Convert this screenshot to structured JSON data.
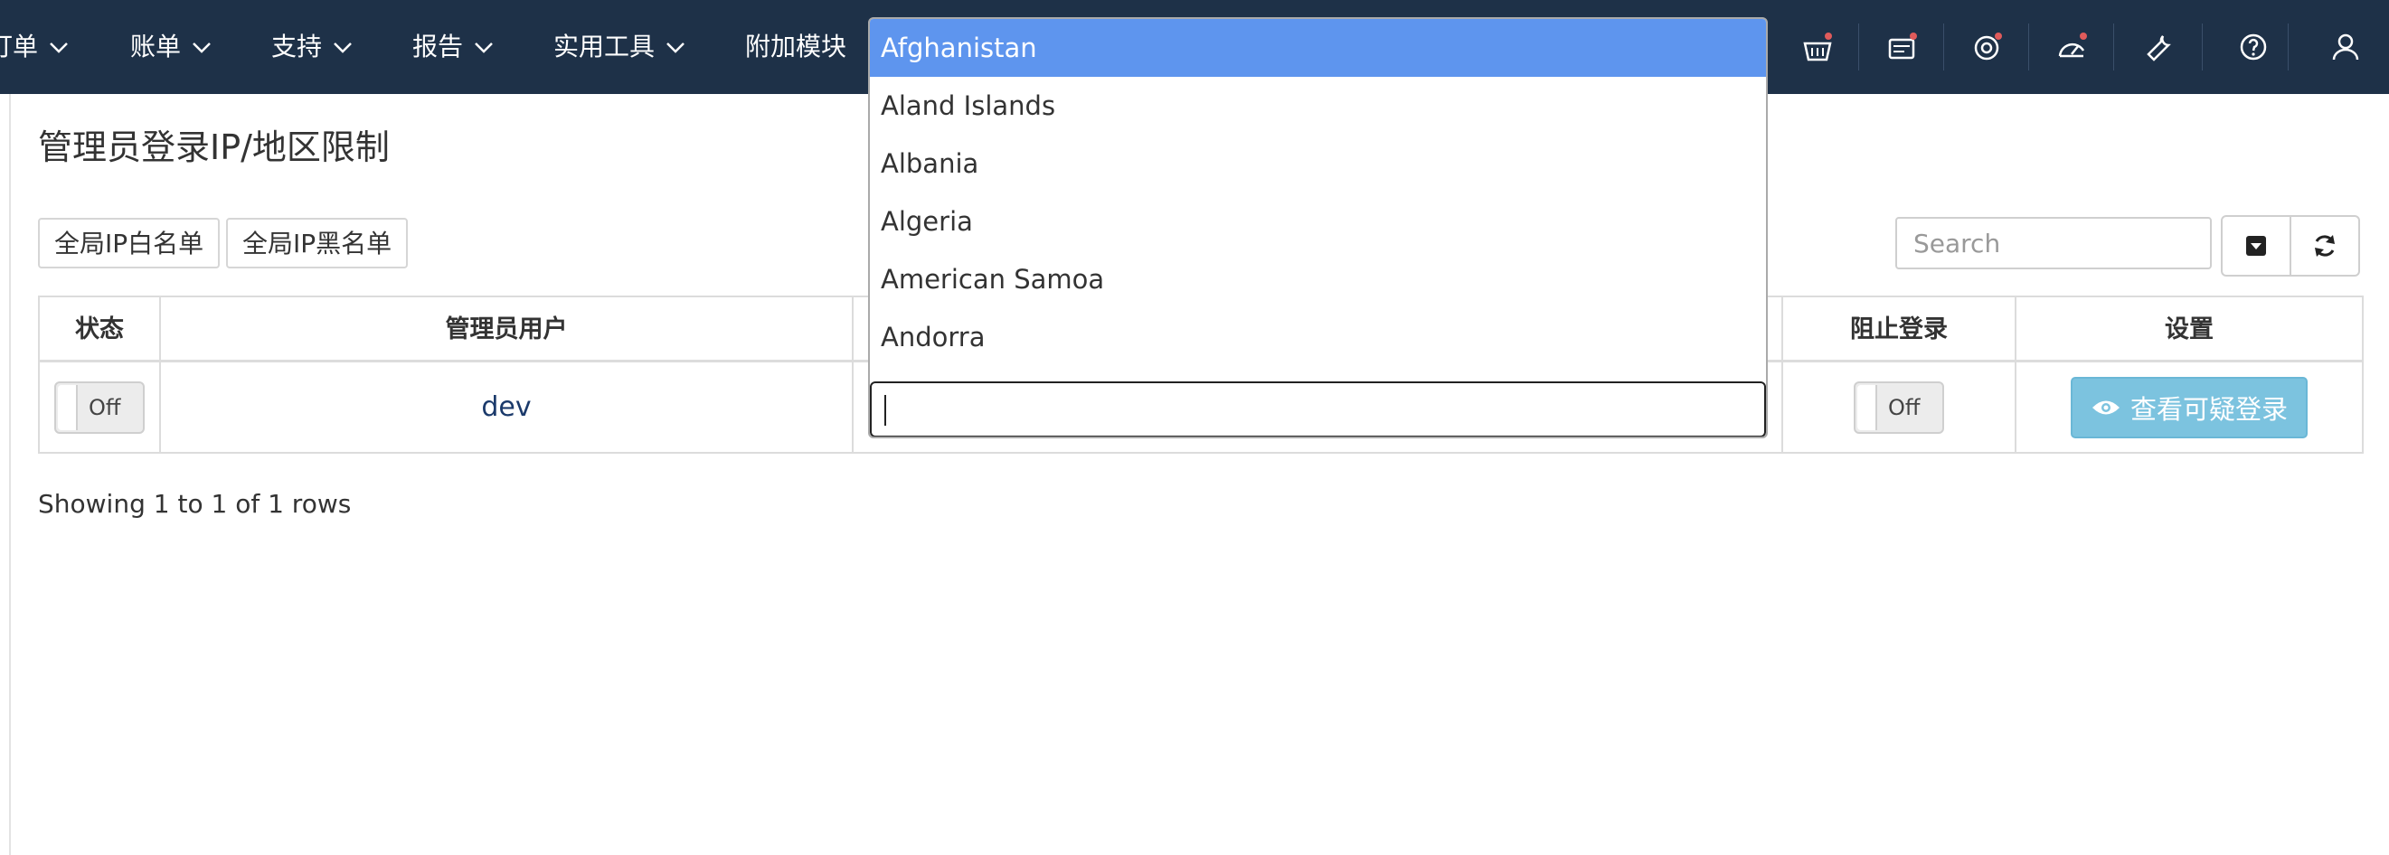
{
  "nav": {
    "items": [
      {
        "label": "订单"
      },
      {
        "label": "账单"
      },
      {
        "label": "支持"
      },
      {
        "label": "报告"
      },
      {
        "label": "实用工具"
      },
      {
        "label": "附加模块"
      }
    ],
    "icons": [
      "basket-icon",
      "billing-icon",
      "support-icon",
      "speedometer-icon",
      "wrench-icon",
      "help-icon",
      "user-icon"
    ]
  },
  "page": {
    "title": "管理员登录IP/地区限制"
  },
  "toolbar": {
    "whitelist_label": "全局IP白名单",
    "blacklist_label": "全局IP黑名单",
    "search_placeholder": "Search"
  },
  "table": {
    "headers": [
      "状态",
      "管理员用户",
      "",
      "阻止登录",
      "设置"
    ],
    "rows": [
      {
        "status": "Off",
        "user": "dev",
        "block": "Off",
        "action": "查看可疑登录"
      }
    ]
  },
  "footer": {
    "showing": "Showing 1 to 1 of 1 rows"
  },
  "dropdown": {
    "options": [
      "Afghanistan",
      "Aland Islands",
      "Albania",
      "Algeria",
      "American Samoa",
      "Andorra"
    ],
    "highlighted": "Afghanistan",
    "search_value": ""
  },
  "colors": {
    "nav_bg": "#1e3148",
    "highlight": "#5e95ee",
    "view_button": "#7cc3df"
  }
}
